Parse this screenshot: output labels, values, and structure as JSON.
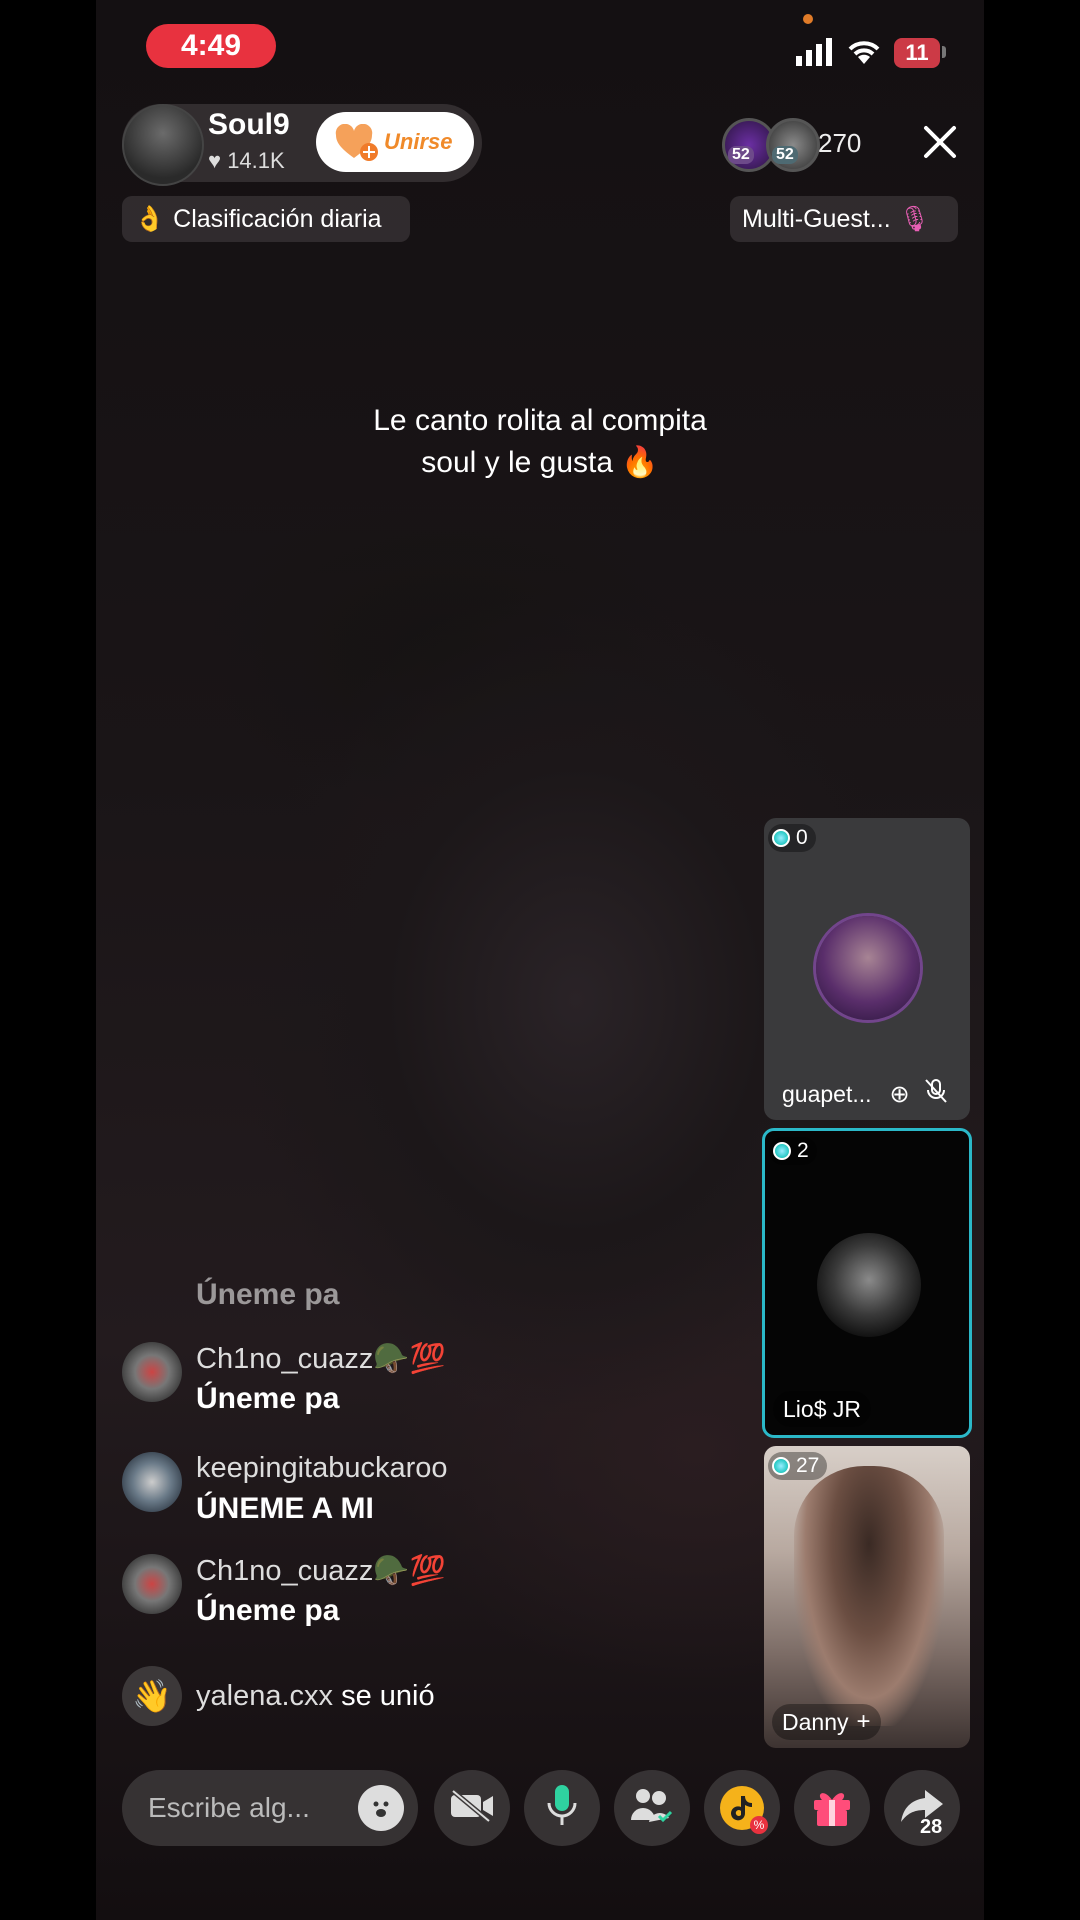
{
  "status_bar": {
    "time": "4:49",
    "battery": "11"
  },
  "host": {
    "name": "Soul9",
    "likes": "14.1K",
    "join_label": "Unirse"
  },
  "viewers": {
    "badge_1": "52",
    "badge_2": "52",
    "count": "270"
  },
  "tags": {
    "ranking": "Clasificación diaria",
    "multi_guest": "Multi-Guest..."
  },
  "caption": {
    "line1": "Le canto rolita al compita",
    "line2": "soul y le gusta 🔥"
  },
  "guests": [
    {
      "count": "0",
      "name": "guapet..."
    },
    {
      "count": "2",
      "name": "Lio$ JR"
    },
    {
      "count": "27",
      "name": "Danny"
    }
  ],
  "chat": {
    "faded_message": "Úneme pa",
    "messages": [
      {
        "user": "Ch1no_cuazz🪖💯",
        "text": "Úneme pa"
      },
      {
        "user": "keepingitabuckaroo",
        "text": "ÚNEME A MI"
      },
      {
        "user": "Ch1no_cuazz🪖💯",
        "text": "Úneme pa"
      }
    ],
    "join_event": {
      "user": "yalena.cxx",
      "text": "se unió"
    }
  },
  "bottom_bar": {
    "input_placeholder": "Escribe alg...",
    "share_count": "28"
  },
  "colors": {
    "time_pill": "#e8323f",
    "join_text": "#f08a2a",
    "active_tile_border": "#2bb8c8"
  }
}
